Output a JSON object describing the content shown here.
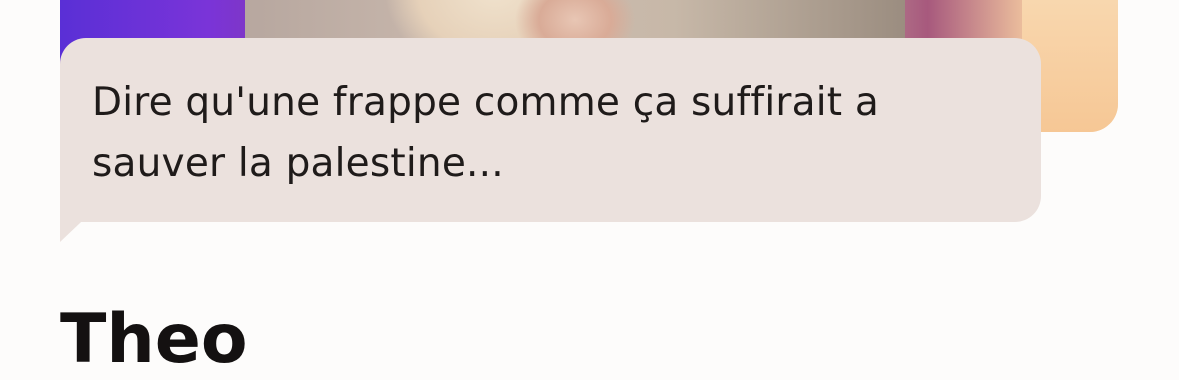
{
  "message": {
    "text": "Dire qu'une frappe comme ça suffirait a sauver la palestine..."
  },
  "profile": {
    "name": "Theo"
  }
}
